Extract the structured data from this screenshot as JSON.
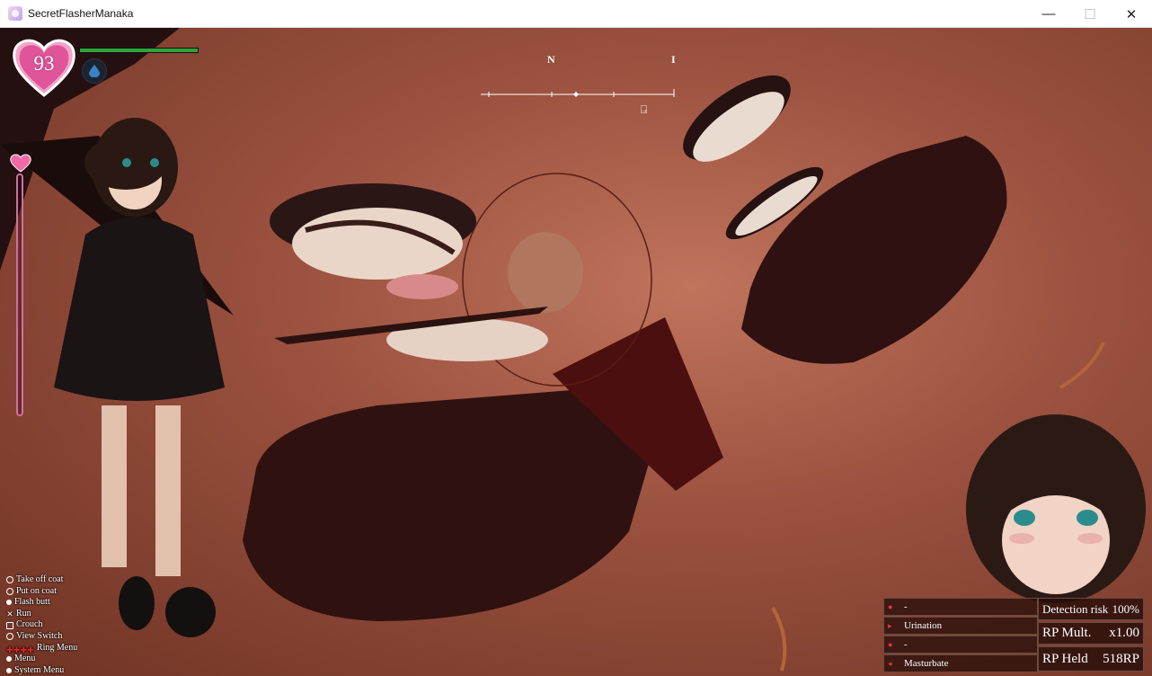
{
  "window": {
    "title": "SecretFlasherManaka",
    "controls": {
      "minimize": "—",
      "maximize": "☐",
      "close": "✕"
    }
  },
  "hud": {
    "heart_value": "93",
    "hp_fraction": 1.0,
    "compass": {
      "north_label": "N",
      "east_label": "I",
      "marker_glyph": "⍈"
    },
    "controls": [
      {
        "icon": "circle",
        "label": "Take off coat"
      },
      {
        "icon": "circle",
        "label": "Put on coat"
      },
      {
        "icon": "dot",
        "label": "Flash butt"
      },
      {
        "icon": "x",
        "label": "Run"
      },
      {
        "icon": "square",
        "label": "Crouch"
      },
      {
        "icon": "circle",
        "label": "View Switch"
      },
      {
        "icon": "dpad",
        "label": "Ring Menu"
      },
      {
        "icon": "dot",
        "label": "Menu"
      },
      {
        "icon": "dot",
        "label": "System Menu"
      }
    ],
    "actions": [
      {
        "label": "-"
      },
      {
        "label": "Urination"
      },
      {
        "label": "-"
      },
      {
        "label": "Masturbate"
      }
    ],
    "stats": {
      "detection_label": "Detection risk",
      "detection_value": "100%",
      "rp_mult_label": "RP Mult.",
      "rp_mult_value": "x1.00",
      "rp_held_label": "RP Held",
      "rp_held_value": "518RP"
    }
  },
  "colors": {
    "hp_bar": "#2fa33b",
    "heart": "#e0559a",
    "gauge_border": "#d36ea0",
    "panel_bg": "#28100a"
  }
}
